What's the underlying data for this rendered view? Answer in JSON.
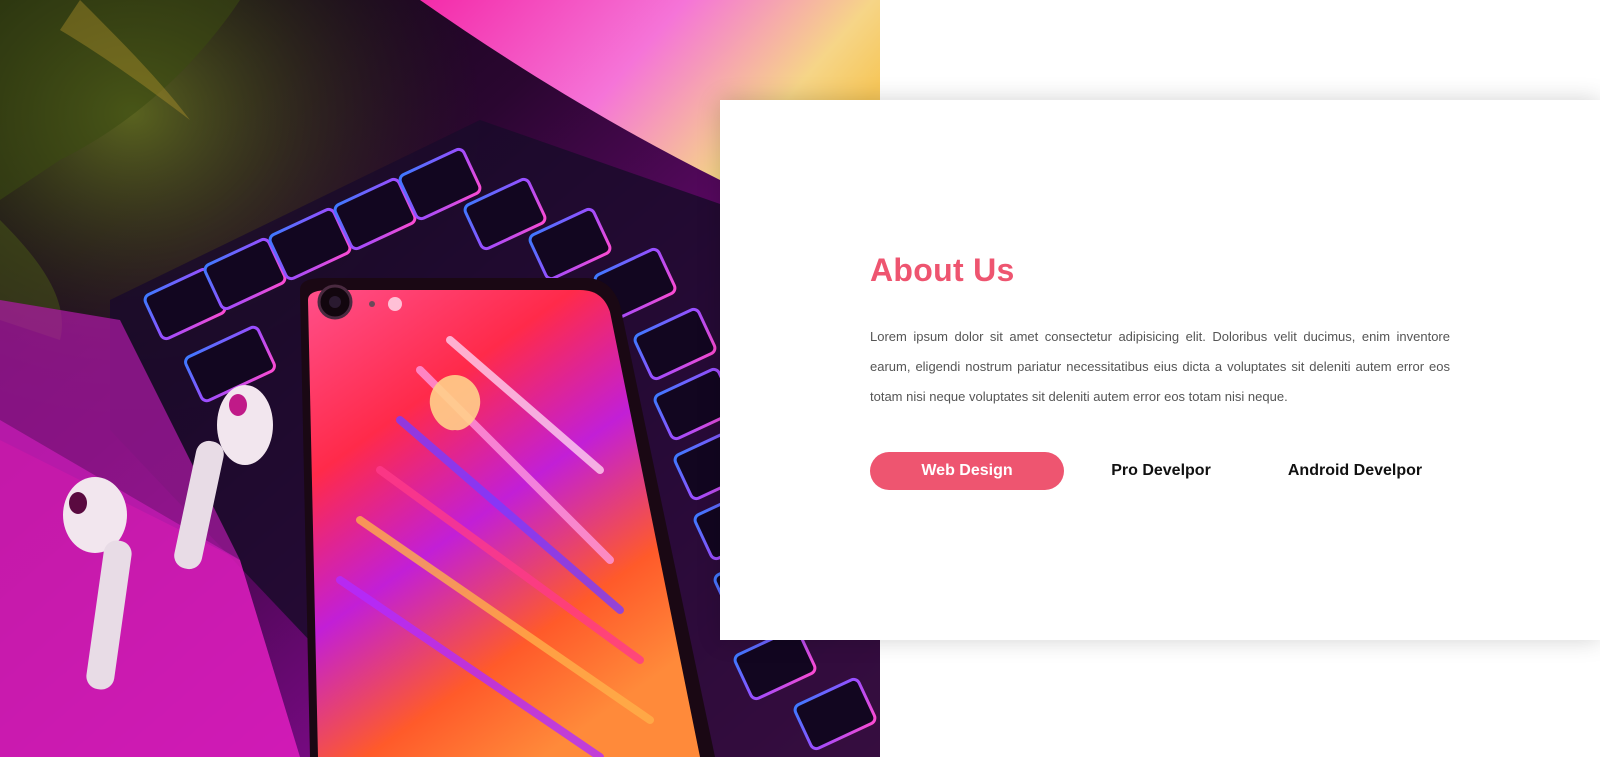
{
  "about": {
    "title": "About Us",
    "text": "Lorem ipsum dolor sit amet consectetur adipisicing elit. Doloribus velit ducimus, enim inventore earum, eligendi nostrum pariatur necessitatibus eius dicta a voluptates sit deleniti autem error eos totam nisi neque voluptates sit deleniti autem error eos totam nisi neque.",
    "tabs": [
      {
        "label": "Web Design",
        "active": true
      },
      {
        "label": "Pro Develpor",
        "active": false
      },
      {
        "label": "Android Develpor",
        "active": false
      }
    ]
  },
  "colors": {
    "accent": "#ee5570",
    "text": "#555555",
    "tab_text": "#111111"
  },
  "hero_image": {
    "icon": "laptop-phone-photo"
  }
}
